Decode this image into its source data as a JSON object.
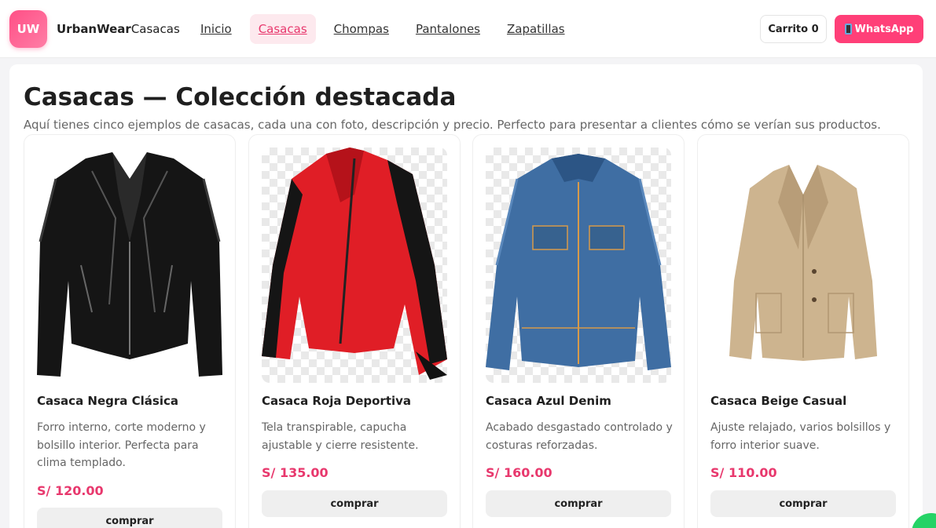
{
  "header": {
    "logo_text": "UW",
    "brand_bold": "UrbanWear",
    "brand_light": "Casacas",
    "nav": [
      {
        "label": "Inicio",
        "active": false
      },
      {
        "label": "Casacas",
        "active": true
      },
      {
        "label": "Chompas",
        "active": false
      },
      {
        "label": "Pantalones",
        "active": false
      },
      {
        "label": "Zapatillas",
        "active": false
      }
    ],
    "cart_label": "Carrito 0",
    "whatsapp_label": "WhatsApp",
    "accent_color": "#ff3f78"
  },
  "main": {
    "title": "Casacas — Colección destacada",
    "description": "Aquí tienes cinco ejemplos de casacas, cada una con foto, descripción y precio. Perfecto para presentar a clientes cómo se verían sus productos."
  },
  "products": [
    {
      "name": "Casaca Negra Clásica",
      "description": "Forro interno, corte moderno y bolsillo interior. Perfecta para clima templado.",
      "price": "S/ 120.00",
      "button": "comprar",
      "image": "black-leather-jacket"
    },
    {
      "name": "Casaca Roja Deportiva",
      "description": "Tela transpirable, capucha ajustable y cierre resistente.",
      "price": "S/ 135.00",
      "button": "comprar",
      "image": "red-sport-jacket"
    },
    {
      "name": "Casaca Azul Denim",
      "description": "Acabado desgastado controlado y costuras reforzadas.",
      "price": "S/ 160.00",
      "button": "comprar",
      "image": "blue-denim-jacket"
    },
    {
      "name": "Casaca Beige Casual",
      "description": "Ajuste relajado, varios bolsillos y forro interior suave.",
      "price": "S/ 110.00",
      "button": "comprar",
      "image": "beige-blazer"
    }
  ]
}
